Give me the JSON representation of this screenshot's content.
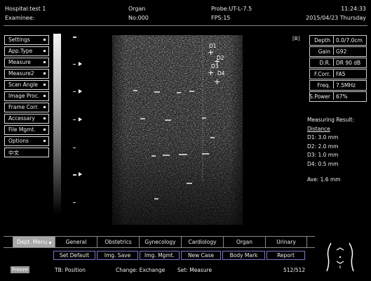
{
  "header": {
    "hospital": "Hospital:test 1",
    "examinee": "Examinee:",
    "organ": "Organ",
    "no": "No:000",
    "probe": "Probe:UT-L-7.5",
    "fps": "FPS:15",
    "time": "11:24:33",
    "date": "2015/04/23 Thursday"
  },
  "left_menu": {
    "items": [
      {
        "label": "Settings"
      },
      {
        "label": "App.Type"
      },
      {
        "label": "Measure"
      },
      {
        "label": "Measure2"
      },
      {
        "label": "Scan Angle"
      },
      {
        "label": "Image Proc."
      },
      {
        "label": "Frame Corr."
      },
      {
        "label": "Accessary"
      },
      {
        "label": "File Mgmt."
      },
      {
        "label": "Options"
      },
      {
        "label": "中文"
      }
    ]
  },
  "image": {
    "b_label": "[B]",
    "marks": [
      "D1",
      "D2",
      "D3",
      "D4"
    ]
  },
  "params": [
    {
      "key": "Depth",
      "value": "0.0/7.0cm"
    },
    {
      "key": "Gain",
      "value": "G92"
    },
    {
      "key": "D.R.",
      "value": "DR 90 dB"
    },
    {
      "key": "F.Corr.",
      "value": "FA5"
    },
    {
      "key": "Freq.",
      "value": "7.5MHz"
    },
    {
      "key": "S.Power",
      "value": "67%"
    }
  ],
  "measuring": {
    "title": "Measuring Result:",
    "subtitle": "Distance",
    "d1": "D1: 3.0 mm",
    "d2": "D2: 2.0 mm",
    "d3": "D3: 1.0 mm",
    "d4": "D4: 0.5 mm",
    "ave": "Ave: 1.6 mm"
  },
  "tabs": [
    "Dept. Menu",
    "General",
    "Obstetrics",
    "Gynecology",
    "Cardiology",
    "Organ",
    "Urinary"
  ],
  "function_buttons": [
    "Set Default",
    "Img. Save",
    "Img. Mgmt.",
    "New Case",
    "Body Mark",
    "Report"
  ],
  "status": {
    "freeze": "Freeze",
    "tb": "TB: Position",
    "change": "Change: Exchange",
    "set": "Set: Measure",
    "frames": "512/512"
  }
}
